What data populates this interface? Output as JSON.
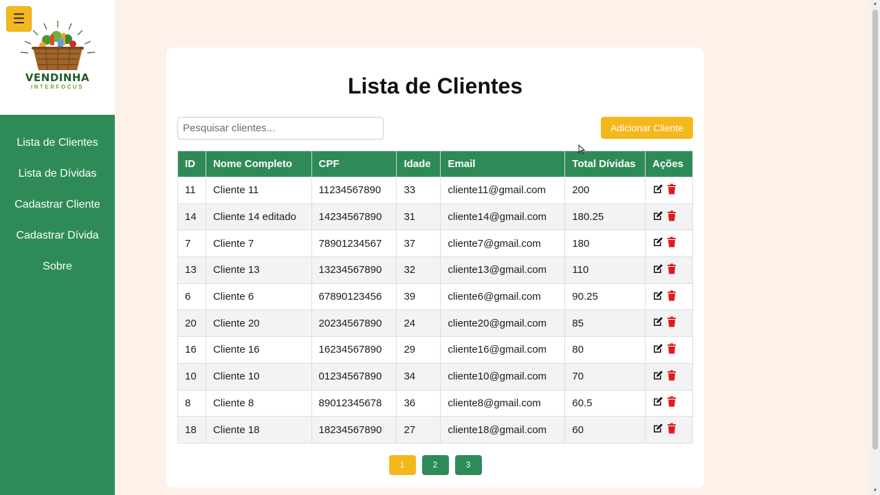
{
  "sidebar": {
    "menu_icon": "menu-icon",
    "logo_title": "VENDINHA",
    "logo_subtitle": "INTERFOCUS",
    "items": [
      {
        "label": "Lista de Clientes"
      },
      {
        "label": "Lista de Dívidas"
      },
      {
        "label": "Cadastrar Cliente"
      },
      {
        "label": "Cadastrar Dívida"
      },
      {
        "label": "Sobre"
      }
    ]
  },
  "main": {
    "title": "Lista de Clientes",
    "search_placeholder": "Pesquisar clientes...",
    "search_value": "",
    "add_button": "Adicionar Cliente"
  },
  "table": {
    "headers": [
      "ID",
      "Nome Completo",
      "CPF",
      "Idade",
      "Email",
      "Total Dívidas",
      "Ações"
    ],
    "rows": [
      [
        "11",
        "Cliente 11",
        "11234567890",
        "33",
        "cliente11@gmail.com",
        "200"
      ],
      [
        "14",
        "Cliente 14 editado",
        "14234567890",
        "31",
        "cliente14@gmail.com",
        "180.25"
      ],
      [
        "7",
        "Cliente 7",
        "78901234567",
        "37",
        "cliente7@gmail.com",
        "180"
      ],
      [
        "13",
        "Cliente 13",
        "13234567890",
        "32",
        "cliente13@gmail.com",
        "110"
      ],
      [
        "6",
        "Cliente 6",
        "67890123456",
        "39",
        "cliente6@gmail.com",
        "90.25"
      ],
      [
        "20",
        "Cliente 20",
        "20234567890",
        "24",
        "cliente20@gmail.com",
        "85"
      ],
      [
        "16",
        "Cliente 16",
        "16234567890",
        "29",
        "cliente16@gmail.com",
        "80"
      ],
      [
        "10",
        "Cliente 10",
        "01234567890",
        "34",
        "cliente10@gmail.com",
        "70"
      ],
      [
        "8",
        "Cliente 8",
        "89012345678",
        "36",
        "cliente8@gmail.com",
        "60.5"
      ],
      [
        "18",
        "Cliente 18",
        "18234567890",
        "27",
        "cliente18@gmail.com",
        "60"
      ]
    ],
    "action_icons": [
      "edit-icon",
      "trash-icon"
    ]
  },
  "pagination": {
    "pages": [
      "1",
      "2",
      "3"
    ],
    "active": "1"
  },
  "colors": {
    "primary_green": "#2e8b57",
    "accent_yellow": "#f4b81c",
    "delete_red": "#e01b1b",
    "page_background": "#fdf1ea"
  }
}
